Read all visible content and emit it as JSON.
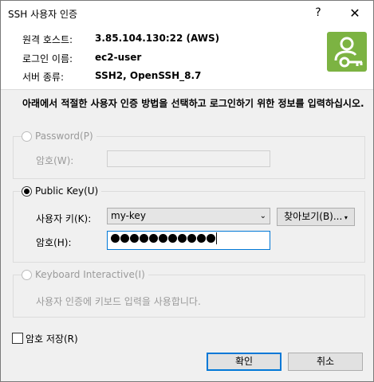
{
  "window": {
    "title": "SSH 사용자 인증",
    "help_glyph": "?",
    "close_glyph": "✕"
  },
  "info": {
    "host_label": "원격 호스트:",
    "host_value": "3.85.104.130:22 (AWS)",
    "login_label": "로그인 이름:",
    "login_value": "ec2-user",
    "server_label": "서버 종류:",
    "server_value": "SSH2, OpenSSH_8.7"
  },
  "description": "아래에서 적절한 사용자 인증 방법을 선택하고 로그인하기 위한 정보를 입력하십시오.",
  "password_group": {
    "radio_label": "Password(P)",
    "password_label": "암호(W):"
  },
  "pubkey_group": {
    "radio_label": "Public Key(U)",
    "userkey_label": "사용자 키(K):",
    "userkey_value": "my-key",
    "browse_label": "찾아보기(B)...",
    "passphrase_label": "암호(H):",
    "passphrase_length": 11
  },
  "kbd_group": {
    "radio_label": "Keyboard Interactive(I)",
    "desc": "사용자 인증에 키보드 입력을 사용합니다."
  },
  "save_password_label": "암호 저장(R)",
  "ok_label": "확인",
  "cancel_label": "취소",
  "colors": {
    "logo_green": "#7cb342",
    "focus_blue": "#0078d7"
  }
}
